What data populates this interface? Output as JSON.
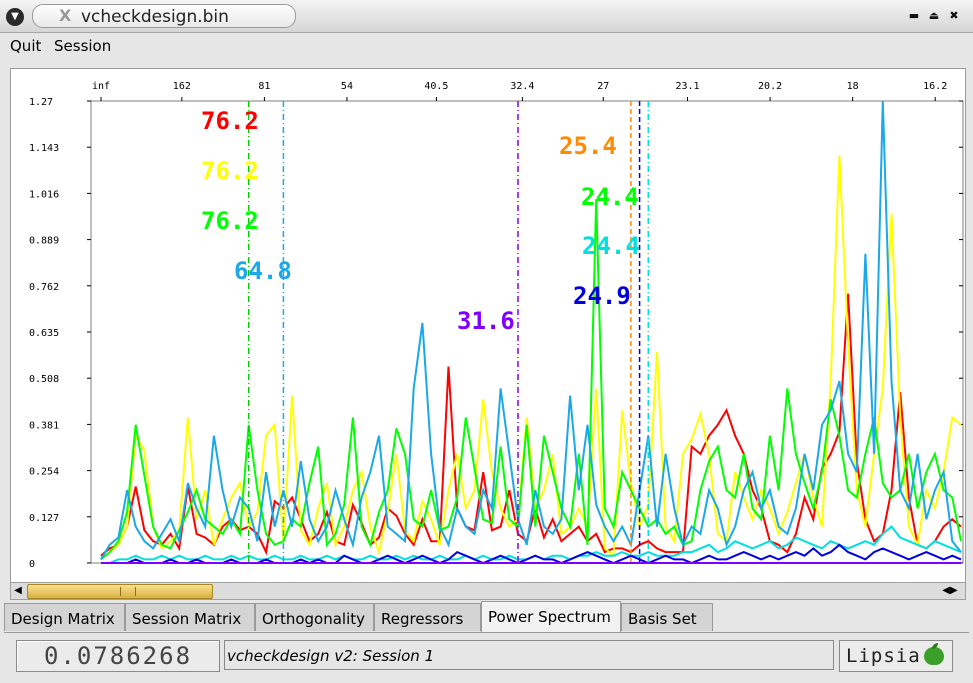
{
  "window": {
    "title": "vcheckdesign.bin",
    "buttons": {
      "minimize": "▬",
      "maximize": "⏏",
      "close": "✖"
    }
  },
  "menu": [
    "Quit",
    "Session"
  ],
  "chart_data": {
    "type": "line",
    "x_top_ticks": [
      "inf",
      "162",
      "81",
      "54",
      "40.5",
      "32.4",
      "27",
      "23.1",
      "20.2",
      "18",
      "16.2"
    ],
    "y_ticks": [
      "1.27",
      "1.143",
      "1.016",
      "0.889",
      "0.762",
      "0.635",
      "0.508",
      "0.381",
      "0.254",
      "0.127",
      "0"
    ],
    "ylim": [
      0,
      1.27
    ],
    "n_points": 100,
    "series": [
      {
        "color": "#ff0000",
        "values": [
          0.02,
          0.04,
          0.05,
          0.1,
          0.21,
          0.09,
          0.06,
          0.05,
          0.08,
          0.04,
          0.21,
          0.08,
          0.07,
          0.05,
          0.1,
          0.12,
          0.09,
          0.1,
          0.08,
          0.03,
          0.17,
          0.15,
          0.18,
          0.12,
          0.06,
          0.08,
          0.14,
          0.06,
          0.05,
          0.16,
          0.11,
          0.05,
          0.07,
          0.15,
          0.13,
          0.08,
          0.05,
          0.12,
          0.06,
          0.06,
          0.54,
          0.15,
          0.1,
          0.09,
          0.25,
          0.09,
          0.1,
          0.2,
          0.08,
          0.06,
          0.15,
          0.07,
          0.12,
          0.06,
          0.08,
          0.1,
          0.06,
          0.08,
          0.03,
          0.04,
          0.04,
          0.03,
          0.05,
          0.06,
          0.04,
          0.03,
          0.03,
          0.03,
          0.32,
          0.3,
          0.35,
          0.38,
          0.42,
          0.35,
          0.3,
          0.2,
          0.15,
          0.06,
          0.05,
          0.03,
          0.08,
          0.18,
          0.12,
          0.26,
          0.3,
          0.36,
          0.74,
          0.28,
          0.12,
          0.06,
          0.08,
          0.2,
          0.47,
          0.18,
          0.05,
          0.04,
          0.06,
          0.1,
          0.12,
          0.1
        ]
      },
      {
        "color": "#ffff00",
        "values": [
          0.01,
          0.03,
          0.05,
          0.1,
          0.35,
          0.31,
          0.1,
          0.04,
          0.06,
          0.09,
          0.4,
          0.12,
          0.2,
          0.05,
          0.12,
          0.18,
          0.22,
          0.1,
          0.14,
          0.35,
          0.38,
          0.06,
          0.46,
          0.09,
          0.05,
          0.15,
          0.22,
          0.05,
          0.1,
          0.2,
          0.25,
          0.1,
          0.03,
          0.14,
          0.3,
          0.09,
          0.06,
          0.17,
          0.12,
          0.05,
          0.2,
          0.3,
          0.15,
          0.2,
          0.45,
          0.25,
          0.15,
          0.1,
          0.12,
          0.4,
          0.15,
          0.2,
          0.3,
          0.08,
          0.1,
          0.15,
          0.1,
          0.48,
          0.04,
          0.02,
          0.42,
          0.22,
          0.1,
          0.16,
          0.58,
          0.1,
          0.06,
          0.3,
          0.34,
          0.41,
          0.3,
          0.08,
          0.06,
          0.25,
          0.18,
          0.12,
          0.2,
          0.15,
          0.08,
          0.14,
          0.22,
          0.3,
          0.18,
          0.1,
          0.5,
          1.12,
          0.6,
          0.2,
          0.1,
          0.3,
          0.48,
          0.96,
          0.4,
          0.1,
          0.05,
          0.2,
          0.15,
          0.25,
          0.4,
          0.38
        ]
      },
      {
        "color": "#00ff00",
        "values": [
          0.01,
          0.03,
          0.06,
          0.14,
          0.38,
          0.24,
          0.1,
          0.05,
          0.04,
          0.09,
          0.14,
          0.2,
          0.12,
          0.1,
          0.08,
          0.12,
          0.08,
          0.38,
          0.2,
          0.08,
          0.05,
          0.06,
          0.12,
          0.1,
          0.22,
          0.32,
          0.05,
          0.08,
          0.16,
          0.4,
          0.1,
          0.05,
          0.14,
          0.2,
          0.37,
          0.3,
          0.12,
          0.1,
          0.2,
          0.09,
          0.1,
          0.18,
          0.4,
          0.26,
          0.12,
          0.11,
          0.32,
          0.12,
          0.1,
          0.38,
          0.1,
          0.35,
          0.25,
          0.15,
          0.1,
          0.3,
          0.05,
          1.0,
          0.15,
          0.1,
          0.25,
          0.2,
          0.15,
          0.1,
          0.12,
          0.08,
          0.1,
          0.05,
          0.06,
          0.2,
          0.28,
          0.32,
          0.2,
          0.18,
          0.3,
          0.15,
          0.12,
          0.35,
          0.2,
          0.48,
          0.3,
          0.22,
          0.15,
          0.25,
          0.45,
          0.35,
          0.2,
          0.18,
          0.3,
          0.4,
          0.22,
          0.18,
          0.2,
          0.3,
          0.15,
          0.25,
          0.3,
          0.2,
          0.18,
          0.06
        ]
      },
      {
        "color": "#00e0e0",
        "values": [
          0.0,
          0.0,
          0.01,
          0.01,
          0.02,
          0.01,
          0.01,
          0.02,
          0.01,
          0.02,
          0.01,
          0.01,
          0.02,
          0.01,
          0.01,
          0.02,
          0.01,
          0.02,
          0.01,
          0.01,
          0.02,
          0.01,
          0.01,
          0.02,
          0.01,
          0.01,
          0.02,
          0.01,
          0.02,
          0.01,
          0.01,
          0.02,
          0.01,
          0.01,
          0.02,
          0.01,
          0.02,
          0.01,
          0.01,
          0.02,
          0.01,
          0.01,
          0.02,
          0.01,
          0.02,
          0.01,
          0.01,
          0.02,
          0.01,
          0.01,
          0.02,
          0.01,
          0.02,
          0.02,
          0.01,
          0.02,
          0.02,
          0.03,
          0.02,
          0.02,
          0.03,
          0.02,
          0.02,
          0.03,
          0.02,
          0.02,
          0.02,
          0.03,
          0.03,
          0.04,
          0.05,
          0.03,
          0.04,
          0.06,
          0.05,
          0.04,
          0.05,
          0.06,
          0.04,
          0.05,
          0.07,
          0.06,
          0.05,
          0.04,
          0.06,
          0.05,
          0.04,
          0.05,
          0.06,
          0.05,
          0.08,
          0.1,
          0.07,
          0.06,
          0.05,
          0.04,
          0.06,
          0.05,
          0.04,
          0.03
        ]
      },
      {
        "color": "#1aa8e8",
        "values": [
          0.01,
          0.05,
          0.07,
          0.2,
          0.1,
          0.06,
          0.04,
          0.08,
          0.12,
          0.06,
          0.22,
          0.15,
          0.1,
          0.35,
          0.2,
          0.1,
          0.18,
          0.15,
          0.06,
          0.25,
          0.1,
          0.2,
          0.1,
          0.28,
          0.12,
          0.06,
          0.1,
          0.2,
          0.12,
          0.05,
          0.18,
          0.25,
          0.35,
          0.1,
          0.08,
          0.06,
          0.48,
          0.66,
          0.3,
          0.1,
          0.05,
          0.15,
          0.1,
          0.08,
          0.2,
          0.15,
          0.48,
          0.3,
          0.12,
          0.05,
          0.2,
          0.1,
          0.08,
          0.12,
          0.46,
          0.2,
          0.38,
          0.16,
          0.1,
          0.06,
          0.1,
          0.05,
          0.2,
          0.35,
          0.1,
          0.3,
          0.15,
          0.05,
          0.1,
          0.08,
          0.2,
          0.15,
          0.05,
          0.1,
          0.2,
          0.25,
          0.15,
          0.2,
          0.1,
          0.08,
          0.15,
          0.3,
          0.2,
          0.38,
          0.42,
          0.5,
          0.3,
          0.25,
          0.85,
          0.3,
          1.27,
          0.5,
          0.2,
          0.15,
          0.3,
          0.12,
          0.2,
          0.25,
          0.06,
          0.03
        ]
      },
      {
        "color": "#0000e0",
        "values": [
          0.0,
          0.0,
          0.0,
          0.0,
          0.01,
          0.0,
          0.0,
          0.0,
          0.01,
          0.0,
          0.0,
          0.01,
          0.0,
          0.0,
          0.0,
          0.01,
          0.0,
          0.0,
          0.0,
          0.01,
          0.0,
          0.0,
          0.0,
          0.01,
          0.0,
          0.01,
          0.0,
          0.0,
          0.02,
          0.01,
          0.0,
          0.0,
          0.01,
          0.02,
          0.01,
          0.0,
          0.01,
          0.02,
          0.01,
          0.0,
          0.01,
          0.03,
          0.02,
          0.01,
          0.0,
          0.01,
          0.02,
          0.01,
          0.0,
          0.01,
          0.02,
          0.01,
          0.01,
          0.0,
          0.01,
          0.02,
          0.03,
          0.02,
          0.01,
          0.0,
          0.01,
          0.02,
          0.01,
          0.0,
          0.01,
          0.02,
          0.01,
          0.01,
          0.0,
          0.01,
          0.02,
          0.01,
          0.01,
          0.02,
          0.03,
          0.02,
          0.01,
          0.02,
          0.01,
          0.02,
          0.03,
          0.02,
          0.04,
          0.02,
          0.03,
          0.05,
          0.03,
          0.02,
          0.01,
          0.03,
          0.04,
          0.03,
          0.02,
          0.01,
          0.02,
          0.03,
          0.02,
          0.01,
          0.02,
          0.01
        ]
      },
      {
        "color": "#8000ff",
        "values": [
          0.0,
          0.0,
          0.0,
          0.0,
          0.0,
          0.0,
          0.0,
          0.0,
          0.0,
          0.0,
          0.0,
          0.0,
          0.0,
          0.0,
          0.0,
          0.0,
          0.0,
          0.0,
          0.0,
          0.0,
          0.0,
          0.0,
          0.0,
          0.0,
          0.0,
          0.0,
          0.0,
          0.0,
          0.0,
          0.0,
          0.0,
          0.0,
          0.0,
          0.0,
          0.0,
          0.0,
          0.0,
          0.0,
          0.0,
          0.0,
          0.0,
          0.0,
          0.0,
          0.0,
          0.0,
          0.0,
          0.0,
          0.0,
          0.0,
          0.0,
          0.0,
          0.0,
          0.0,
          0.0,
          0.0,
          0.0,
          0.0,
          0.0,
          0.0,
          0.0,
          0.0,
          0.0,
          0.0,
          0.0,
          0.0,
          0.0,
          0.0,
          0.0,
          0.0,
          0.0,
          0.0,
          0.0,
          0.0,
          0.0,
          0.0,
          0.0,
          0.0,
          0.0,
          0.0,
          0.0,
          0.0,
          0.0,
          0.0,
          0.0,
          0.0,
          0.0,
          0.0,
          0.0,
          0.0,
          0.0,
          0.0,
          0.0,
          0.0,
          0.0,
          0.0,
          0.0,
          0.0,
          0.0,
          0.0,
          0.0
        ]
      }
    ],
    "markers": [
      {
        "color": "#00cc00",
        "index": 17,
        "style": "dashdot"
      },
      {
        "color": "#1aa8e8",
        "index": 21,
        "style": "dashdot"
      },
      {
        "color": "#8000ff",
        "index": 48,
        "style": "dashdot"
      },
      {
        "color": "#ff8c00",
        "index": 61,
        "style": "dashed"
      },
      {
        "color": "#0000e0",
        "index": 62,
        "style": "dashed"
      },
      {
        "color": "#00e0e0",
        "index": 63,
        "style": "dashdot"
      }
    ],
    "annotations": [
      {
        "text": "76.2",
        "color": "#ff0000"
      },
      {
        "text": "76.2",
        "color": "#ffff00"
      },
      {
        "text": "76.2",
        "color": "#00ff00"
      },
      {
        "text": "64.8",
        "color": "#1aa8e8"
      },
      {
        "text": "31.6",
        "color": "#8000ff"
      },
      {
        "text": "25.4",
        "color": "#ff8c00"
      },
      {
        "text": "24.4",
        "color": "#00ff00"
      },
      {
        "text": "24.4",
        "color": "#00e0e0"
      },
      {
        "text": "24.9",
        "color": "#0000e0"
      }
    ]
  },
  "tabs": [
    "Design Matrix",
    "Session Matrix",
    "Orthogonality",
    "Regressors",
    "Power Spectrum",
    "Basis Set"
  ],
  "active_tab": "Power Spectrum",
  "status": {
    "value": "0.0786268",
    "message": "vcheckdesign v2: Session 1",
    "logo": "Lipsia"
  }
}
